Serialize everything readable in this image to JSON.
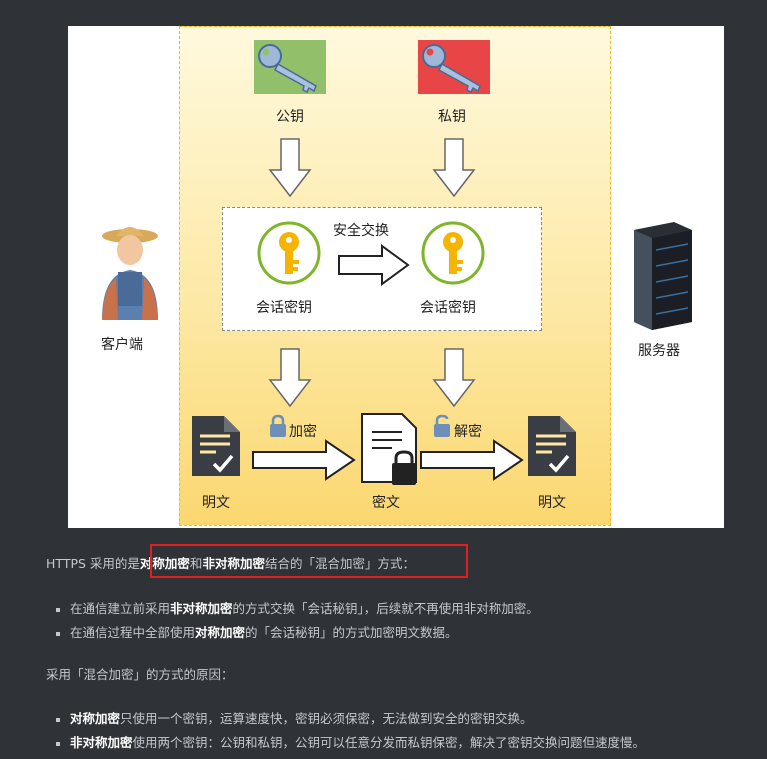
{
  "diagram": {
    "public_key_label": "公钥",
    "private_key_label": "私钥",
    "secure_exchange_label": "安全交换",
    "session_key_left_label": "会话密钥",
    "session_key_right_label": "会话密钥",
    "client_label": "客户端",
    "server_label": "服务器",
    "encrypt_label": "加密",
    "decrypt_label": "解密",
    "plaintext_left_label": "明文",
    "ciphertext_label": "密文",
    "plaintext_right_label": "明文",
    "colors": {
      "public_key_bg": "#92c06a",
      "private_key_bg": "#e84646",
      "key_gold": "#f4b400",
      "ring_green": "#7fb52a",
      "doc_dark": "#3a3e44"
    }
  },
  "text": {
    "intro": {
      "p1": "HTTPS 采用的是",
      "b1": "对称加密",
      "p2": "和",
      "b2": "非对称加密",
      "p3": "结合的「混合加密」方式："
    },
    "bullets1": [
      {
        "pre": "在通信建立前采用",
        "bold": "非对称加密",
        "post": "的方式交换「会话秘钥」，后续就不再使用非对称加密。"
      },
      {
        "pre": "在通信过程中全部使用",
        "bold": "对称加密",
        "post": "的「会话秘钥」的方式加密明文数据。"
      }
    ],
    "reason_intro": "采用「混合加密」的方式的原因：",
    "bullets2": [
      {
        "pre": "",
        "bold": "对称加密",
        "post": "只使用一个密钥，运算速度快，密钥必须保密，无法做到安全的密钥交换。"
      },
      {
        "pre": "",
        "bold": "非对称加密",
        "post": "使用两个密钥：公钥和私钥，公钥可以任意分发而私钥保密，解决了密钥交换问题但速度慢。"
      }
    ]
  }
}
